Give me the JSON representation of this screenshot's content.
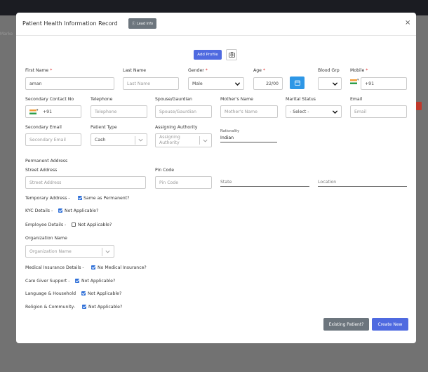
{
  "background": {
    "header_text": "Marke"
  },
  "modal": {
    "title": "Patient Health Information Record",
    "lead_info_button": "Lead Info",
    "close": "×"
  },
  "profile": {
    "add_button": "Add Profile"
  },
  "fields": {
    "first_name": {
      "label": "First Name",
      "value": "aman"
    },
    "last_name": {
      "label": "Last Name",
      "placeholder": "Last Name"
    },
    "gender": {
      "label": "Gender",
      "value": "Male"
    },
    "age": {
      "label": "Age",
      "value": "22/00"
    },
    "blood_grp": {
      "label": "Blood Grp",
      "value": ""
    },
    "mobile": {
      "label": "Mobile",
      "value": "+91"
    },
    "secondary_contact": {
      "label": "Secondary Contact No",
      "value": "+91"
    },
    "telephone": {
      "label": "Telephone",
      "placeholder": "Telephone"
    },
    "spouse": {
      "label": "Spouse/Gaurdian",
      "placeholder": "Spouse/Gaurdian"
    },
    "mother": {
      "label": "Mother's Name",
      "placeholder": "Mother's Name"
    },
    "marital": {
      "label": "Marital Status",
      "value": "- Select -"
    },
    "email": {
      "label": "Email",
      "placeholder": "Email"
    },
    "secondary_email": {
      "label": "Secondary Email",
      "placeholder": "Secondary Email"
    },
    "patient_type": {
      "label": "Patient Type",
      "value": "Cash"
    },
    "assigning_authority": {
      "label": "Assigning Authority",
      "value": "Assigning Authority"
    },
    "nationality": {
      "label": "Nationality",
      "value": "Indian"
    }
  },
  "address": {
    "section_title": "Permanent Address",
    "street_label": "Street Address",
    "street_placeholder": "Street Address",
    "pin_label": "Pin Code",
    "pin_placeholder": "Pin Code",
    "state": "State",
    "location": "Location"
  },
  "options": {
    "temporary_address": "Temporary Address -",
    "same_as_permanent": "Same as Permanent?",
    "kyc": "KYC Details -",
    "kyc_na": "Not Applicable?",
    "employee": "Employee Details -",
    "employee_na": "Not Applicable?",
    "org_label": "Organization Name",
    "org_placeholder": "Organization Name",
    "medical": "Medical Insurance Details -",
    "medical_na": "No Medical Insurance?",
    "caregiver": "Care Giver Support -",
    "caregiver_na": "Not Applicable?",
    "language": "Language & Household",
    "language_na": "Not Applicable?",
    "religion": "Religion & Community-",
    "religion_na": "Not Applicable?"
  },
  "footer": {
    "existing_patient": "Existing Patient?",
    "create_new": "Create New"
  },
  "colors": {
    "primary": "#4f6ae0",
    "secondary": "#6c757d",
    "checkbox": "#2e6fd8"
  }
}
